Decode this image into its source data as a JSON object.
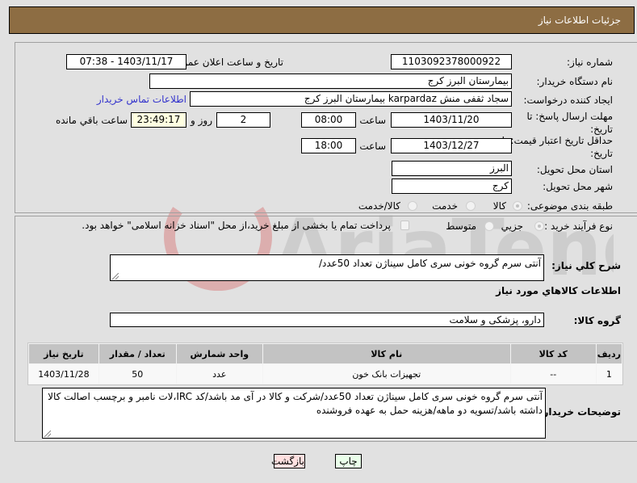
{
  "header": {
    "title": "جزئیات اطلاعات نیاز"
  },
  "fields": {
    "need_number": {
      "label": "شماره نیاز:",
      "value": "1103092378000922"
    },
    "announce_datetime": {
      "label": "تاریخ و ساعت اعلان عمومي:",
      "value": "1403/11/17 - 07:38"
    },
    "buyer_org": {
      "label": "نام دستگاه خریدار:",
      "value": "بیمارستان البرز کرج"
    },
    "requester": {
      "label": "ایجاد کننده درخواست:",
      "value": "سجاد ثقفی منش karpardaz بیمارستان البرز کرج"
    },
    "buyer_contact_link": "اطلاعات تماس خریدار",
    "response_deadline": {
      "label_line1": "مهلت ارسال پاسخ: تا",
      "label_line2": "تاریخ:",
      "date": "1403/11/20",
      "time_label": "ساعت",
      "time": "08:00",
      "days": "2",
      "days_label": "روز و",
      "remaining": "23:49:17",
      "remaining_label": "ساعت باقي مانده"
    },
    "price_validity": {
      "label_line1": "حداقل تاریخ اعتبار قیمت: تا",
      "label_line2": "تاریخ:",
      "date": "1403/12/27",
      "time_label": "ساعت",
      "time": "18:00"
    },
    "delivery_province": {
      "label": "استان محل تحویل:",
      "value": "البرز"
    },
    "delivery_city": {
      "label": "شهر محل تحویل:",
      "value": "کرج"
    },
    "category": {
      "label": "طبقه بندی موضوعی:",
      "options": [
        "کالا",
        "خدمت",
        "کالا/خدمت"
      ],
      "selected": "کالا"
    },
    "purchase_type": {
      "label": "نوع فرآیند خرید :",
      "options": [
        "جزیي",
        "متوسط"
      ],
      "selected": "جزیي",
      "treasury_note": "پرداخت تمام یا بخشی از مبلغ خرید،از محل \"اسناد خزانه اسلامی\" خواهد بود."
    }
  },
  "summary": {
    "label": "شرح كلي نياز:",
    "value": "آنتی سرم گروه خونی سری کامل سیناژن تعداد 50عدد/"
  },
  "goods_section": {
    "title": "اطلاعات كالاهاي مورد نياز",
    "group_label": "گروه کالا:",
    "group_value": "دارو، پزشکی و سلامت",
    "table": {
      "headers": [
        "ردیف",
        "کد کالا",
        "نام کالا",
        "واحد شمارش",
        "تعداد / مقدار",
        "تاریخ نیاز"
      ],
      "rows": [
        [
          "1",
          "--",
          "تجهیزات بانک خون",
          "عدد",
          "50",
          "1403/11/28"
        ]
      ]
    }
  },
  "buyer_notes": {
    "label": "توضیحات خریدار:",
    "value": "آنتی سرم گروه خونی سری کامل سیناژن تعداد 50عدد/شرکت و کالا در آی مد باشد/کد IRC،لات نامبر و برچسب اصالت کالا داشته باشد/تسویه دو ماهه/هزینه حمل به عهده فروشنده"
  },
  "buttons": {
    "print": "چاپ",
    "back": "بازگشت"
  },
  "colors": {
    "header_bg": "#8d6d43",
    "back_btn_bg": "#ffe0e0",
    "print_btn_bg": "#eaffea",
    "link": "#3333cc"
  }
}
